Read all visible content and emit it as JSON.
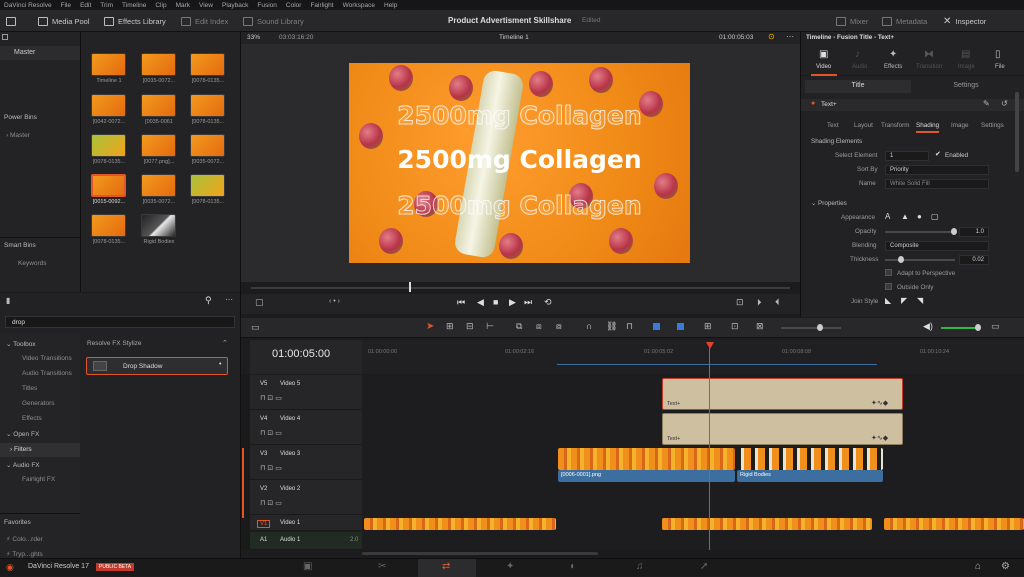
{
  "menu": [
    "DaVinci Resolve",
    "File",
    "Edit",
    "Trim",
    "Timeline",
    "Clip",
    "Mark",
    "View",
    "Playback",
    "Fusion",
    "Color",
    "Fairlight",
    "Workspace",
    "Help"
  ],
  "toolbar": {
    "media_pool": "Media Pool",
    "effects_library": "Effects Library",
    "edit_index": "Edit Index",
    "sound_library": "Sound Library",
    "project": "Product Advertisment Skillshare",
    "edited": "Edited",
    "mixer": "Mixer",
    "metadata": "Metadata",
    "inspector": "Inspector"
  },
  "bins": {
    "master": "Master",
    "power_bins": "Power Bins",
    "power_master": "Master",
    "smart_bins": "Smart Bins",
    "keywords": "Keywords"
  },
  "thumbs": [
    "Timeline 1",
    "[0035-0072...",
    "[0078-0135...",
    "[0042-0072...",
    "[0035-0061",
    "[0078-0135...",
    "[0078-0135...",
    "[0077.png]...",
    "[0035-0072...",
    "[0015-0092...",
    "[0035-0072...",
    "[0078-0135...",
    "[0078-0135...",
    "Rigid Bodies"
  ],
  "viewer": {
    "zoom": "33%",
    "tc_left": "03:03:16:20",
    "timeline": "Timeline 1",
    "tc_right": "01:00:05:03",
    "caption": "2500mg Collagen"
  },
  "inspector": {
    "header": "Timeline - Fusion Title - Text+",
    "tabs": [
      "Video",
      "Audio",
      "Effects",
      "Transition",
      "Image",
      "File"
    ],
    "sub_tabs": [
      "Title",
      "Settings"
    ],
    "node": "Text+",
    "text_tabs": [
      "Text",
      "Layout",
      "Transform",
      "Shading",
      "Image",
      "Settings"
    ],
    "shading_elements": "Shading Elements",
    "select_element_label": "Select Element",
    "select_element_value": "1",
    "enabled": "Enabled",
    "sort_by_label": "Sort By",
    "sort_by_value": "Priority",
    "name_label": "Name",
    "name_value": "White Solid Fill",
    "properties": "Properties",
    "appearance": "Appearance",
    "opacity": "Opacity",
    "opacity_value": "1.0",
    "blending": "Blending",
    "blending_value": "Composite",
    "thickness": "Thickness",
    "thickness_value": "0.02",
    "adapt": "Adapt to Perspective",
    "outside_only": "Outside Only",
    "join_style": "Join Style"
  },
  "effects": {
    "search_value": "drop",
    "toolbox": "Toolbox",
    "video_transitions": "Video Transitions",
    "audio_transitions": "Audio Transitions",
    "titles": "Titles",
    "generators": "Generators",
    "effects": "Effects",
    "open_fx": "Open FX",
    "filters": "Filters",
    "audio_fx": "Audio FX",
    "fairlight_fx": "Fairlight FX",
    "favorites": "Favorites",
    "fav1": "Colo...rder",
    "fav2": "Tryp...ghts",
    "section": "Resolve FX Stylize",
    "drop_shadow": "Drop Shadow"
  },
  "timeline": {
    "timecode": "01:00:05:00",
    "ruler": [
      "01:00:00:00",
      "01:00:02:16",
      "01:00:05:02",
      "01:00:08:08",
      "01:00:10:24"
    ],
    "tracks": [
      {
        "id": "V5",
        "name": "Video 5"
      },
      {
        "id": "V4",
        "name": "Video 4"
      },
      {
        "id": "V3",
        "name": "Video 3"
      },
      {
        "id": "V2",
        "name": "Video 2"
      },
      {
        "id": "V1",
        "name": "Video 1"
      },
      {
        "id": "A1",
        "name": "Audio 1",
        "level": "2.0"
      }
    ],
    "clip_text1": "Text+",
    "clip_text2": "Text+",
    "clip_png": "[0006-0001].png",
    "clip_rigid": "Rigid Bodies"
  },
  "bottom": {
    "app": "DaVinci Resolve 17",
    "badge": "PUBLIC BETA"
  },
  "colors": {
    "accent": "#e2552b",
    "playhead": "#e8412b",
    "title_clip": "#cdbf9f",
    "orange": "#f08f1b",
    "blue_bar": "#3c6e9f"
  }
}
